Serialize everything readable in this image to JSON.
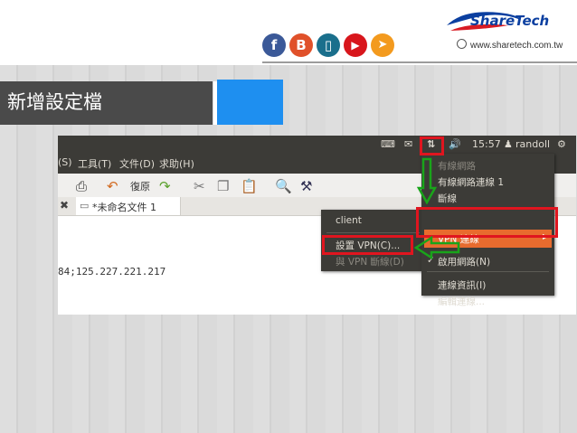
{
  "brand": {
    "logo_text": "ShareTech",
    "website": "www.sharetech.com.tw",
    "social_icons": [
      "facebook-icon",
      "blogger-icon",
      "mobile-icon",
      "youtube-icon",
      "send-icon"
    ]
  },
  "page_title": "新增設定檔",
  "screenshot": {
    "system_tray": {
      "time": "15:57",
      "user": "randoll"
    },
    "menubar": [
      "(S)",
      "工具(T)",
      "文件(D)",
      "求助(H)"
    ],
    "toolbar": {
      "undo_label": "復原"
    },
    "tab_label": "*未命名文件 1",
    "document_text": "84;125.227.221.217",
    "vpn_submenu": {
      "items": [
        {
          "label": "client",
          "disabled": false
        },
        {
          "label": "設置 VPN(C)...",
          "disabled": false
        },
        {
          "label": "與 VPN 斷線(D)",
          "disabled": true
        }
      ]
    },
    "network_menu": {
      "items": [
        {
          "label": "有線網路",
          "disabled": true
        },
        {
          "label": "有線網路連線 1",
          "disabled": false
        },
        {
          "label": "斷線",
          "disabled": false
        },
        {
          "label": "VPN 連線",
          "highlighted": true
        },
        {
          "label": "啟用網路(N)",
          "checked": true
        },
        {
          "label": "連線資訊(I)",
          "disabled": false
        },
        {
          "label": "編輯連線...",
          "disabled": false
        }
      ]
    }
  },
  "colors": {
    "accent_blue": "#1e8ff0",
    "highlight_orange": "#e86b2e",
    "annotation_red": "#e0151f",
    "annotation_green": "#19a41a"
  }
}
